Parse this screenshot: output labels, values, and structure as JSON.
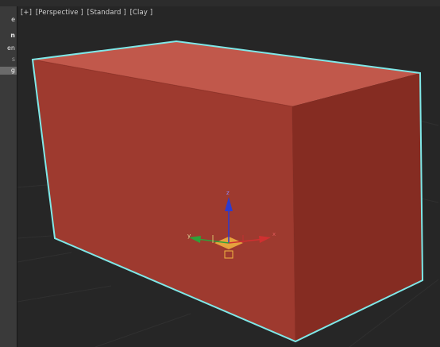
{
  "left_panel": {
    "items": [
      {
        "label": "e"
      },
      {
        "label": "n"
      },
      {
        "label": "en"
      },
      {
        "label": "s"
      },
      {
        "label": "g"
      }
    ]
  },
  "viewport": {
    "labels": [
      "[+]",
      "[Perspective ]",
      "[Standard ]",
      "[Clay ]"
    ]
  },
  "gizmo": {
    "x_label": "x",
    "y_label": "y",
    "z_label": "z"
  },
  "colors": {
    "box_front": "#9e3a2f",
    "box_top": "#c1584b",
    "box_side": "#842c22",
    "selection_outline": "#7fe8e8",
    "axis_x": "#d03030",
    "axis_y": "#2fa13a",
    "axis_z": "#2c3bd0",
    "pivot": "#f2b540"
  }
}
